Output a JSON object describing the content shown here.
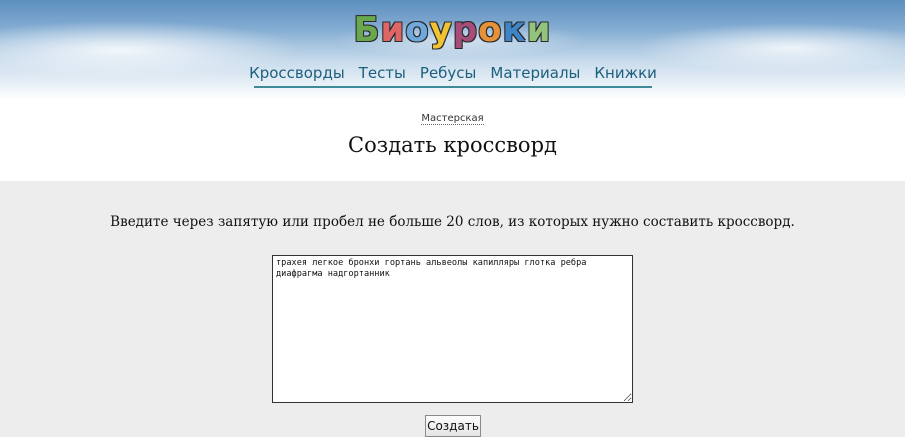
{
  "site": {
    "logo_text": "Биоуроки",
    "logo_letters": [
      "Б",
      "и",
      "о",
      "у",
      "р",
      "о",
      "к",
      "и"
    ],
    "logo_colors": [
      "#6aa84f",
      "#e06666",
      "#6fa8dc",
      "#f1c232",
      "#a64d79",
      "#e69138",
      "#3d85c6",
      "#93c47d"
    ]
  },
  "nav": {
    "items": [
      {
        "label": "Кроссворды"
      },
      {
        "label": "Тесты"
      },
      {
        "label": "Ребусы"
      },
      {
        "label": "Материалы"
      },
      {
        "label": "Книжки"
      }
    ]
  },
  "breadcrumb": {
    "label": "Мастерская"
  },
  "page": {
    "title": "Создать кроссворд",
    "instructions": "Введите через запятую или пробел не больше 20 слов, из которых нужно составить кроссворд."
  },
  "form": {
    "words_value": "трахея легкое бронхи гортань альвеолы капилляры глотка ребра диафрагма надгортанник",
    "submit_label": "Создать"
  },
  "colors": {
    "nav_link": "#1d5f7e",
    "nav_underline": "#3d8a99",
    "content_bg": "#ededed"
  }
}
